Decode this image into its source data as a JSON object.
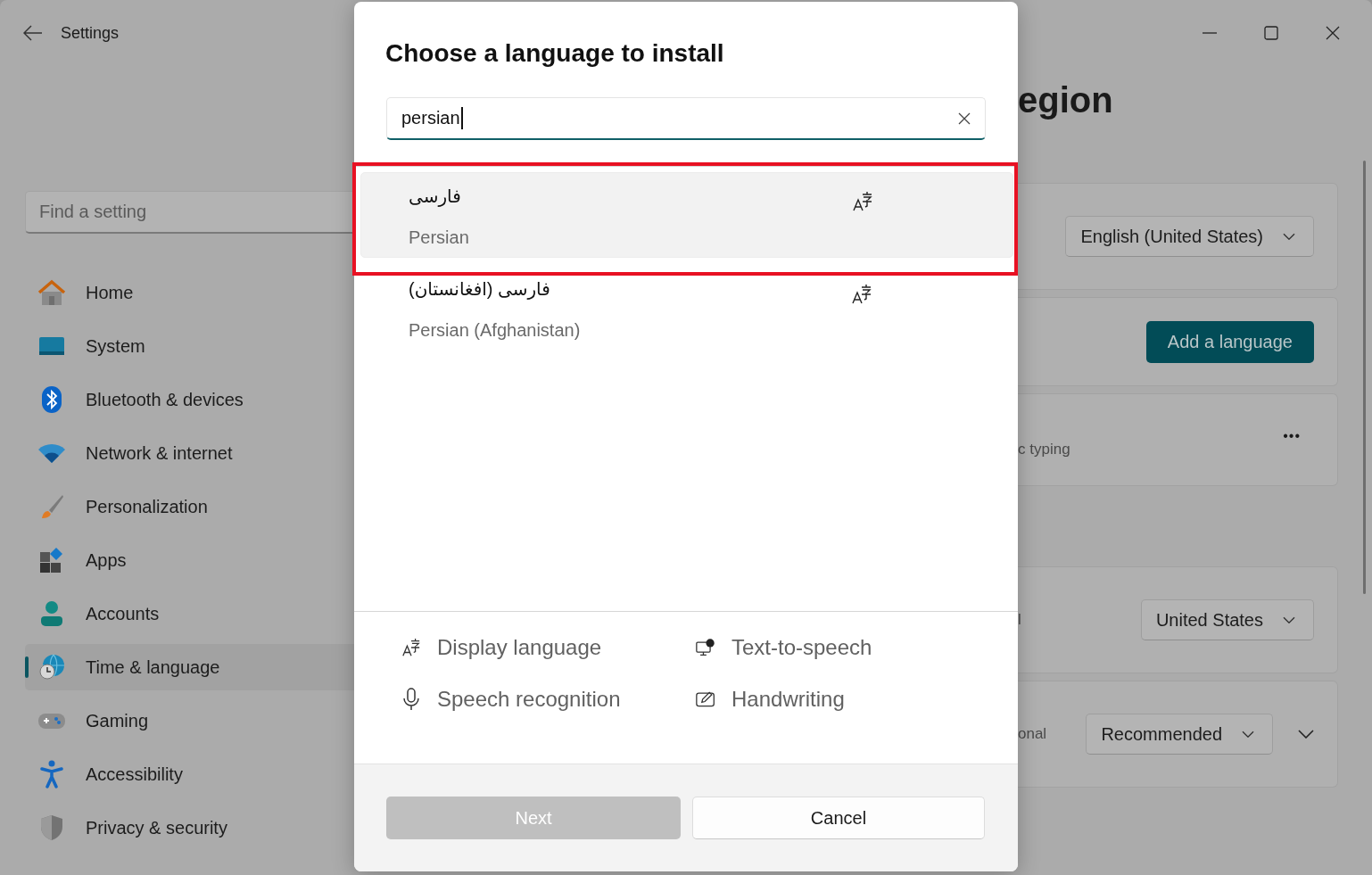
{
  "window": {
    "title": "Settings"
  },
  "sidebar": {
    "search": {
      "placeholder": "Find a setting"
    },
    "items": [
      {
        "label": "Home",
        "selected": false
      },
      {
        "label": "System",
        "selected": false
      },
      {
        "label": "Bluetooth & devices",
        "selected": false
      },
      {
        "label": "Network & internet",
        "selected": false
      },
      {
        "label": "Personalization",
        "selected": false
      },
      {
        "label": "Apps",
        "selected": false
      },
      {
        "label": "Accounts",
        "selected": false
      },
      {
        "label": "Time & language",
        "selected": true
      },
      {
        "label": "Gaming",
        "selected": false
      },
      {
        "label": "Accessibility",
        "selected": false
      },
      {
        "label": "Privacy & security",
        "selected": false
      }
    ]
  },
  "page": {
    "title": "egion",
    "cards": [
      {
        "kind": "dropdown",
        "value": "English (United States)"
      },
      {
        "kind": "button",
        "label": "Add a language"
      },
      {
        "kind": "more",
        "text": "c typing",
        "action": "•••"
      },
      {
        "kind": "dropdown",
        "text": "l",
        "value": "United States"
      },
      {
        "kind": "dropdown-expand",
        "text": "onal",
        "value": "Recommended"
      }
    ]
  },
  "dialog": {
    "title": "Choose a language to install",
    "search": {
      "value": "persian"
    },
    "results": [
      {
        "native": "فارسی",
        "name": "Persian",
        "display_language": true,
        "selected": true,
        "highlighted": true
      },
      {
        "native": "فارسی (افغانستان)",
        "name": "Persian (Afghanistan)",
        "display_language": true,
        "selected": false,
        "highlighted": false
      }
    ],
    "features": [
      {
        "kind": "display",
        "label": "Display language"
      },
      {
        "kind": "tts",
        "label": "Text-to-speech"
      },
      {
        "kind": "speech",
        "label": "Speech recognition"
      },
      {
        "kind": "handwriting",
        "label": "Handwriting"
      }
    ],
    "buttons": [
      {
        "label": "Next",
        "primary": true,
        "disabled": true
      },
      {
        "label": "Cancel",
        "primary": false,
        "disabled": false
      }
    ]
  }
}
